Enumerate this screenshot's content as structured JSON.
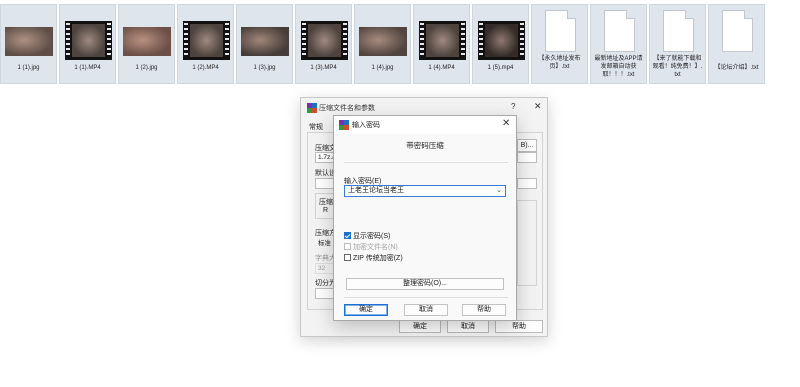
{
  "files": [
    {
      "name": "1 (1).jpg",
      "kind": "image"
    },
    {
      "name": "1 (1).MP4",
      "kind": "video"
    },
    {
      "name": "1 (2).jpg",
      "kind": "image"
    },
    {
      "name": "1 (2).MP4",
      "kind": "video"
    },
    {
      "name": "1 (3).jpg",
      "kind": "image"
    },
    {
      "name": "1 (3).MP4",
      "kind": "video"
    },
    {
      "name": "1 (4).jpg",
      "kind": "image"
    },
    {
      "name": "1 (4).MP4",
      "kind": "video"
    },
    {
      "name": "1 (5).mp4",
      "kind": "video"
    },
    {
      "name": "【永久地址发布页】.txt",
      "kind": "text"
    },
    {
      "name": "最新地址及APP请发邮箱自动获取！！！.txt",
      "kind": "text"
    },
    {
      "name": "【来了就能下载和观看！纯免费！】.txt",
      "kind": "text"
    },
    {
      "name": "【论坛介绍】.txt",
      "kind": "text"
    }
  ],
  "archive_window": {
    "title": "压缩文件名和参数",
    "help_glyph": "?",
    "close_glyph": "✕",
    "tab_general": "常规",
    "label_archive": "压缩文",
    "archive_value": "1.7z.a",
    "browse_partial": "B)...",
    "label_default": "默认设",
    "label_format": "压缩文",
    "radio_partial": "R",
    "label_method": "压缩方",
    "method_value": "标准",
    "label_dict": "字典大",
    "dict_value": "32",
    "label_split": "切分为",
    "ok": "确定",
    "cancel": "取消",
    "help": "帮助"
  },
  "password_dialog": {
    "title": "输入密码",
    "close_glyph": "✕",
    "subtitle": "带密码压缩",
    "password_label": "输入密码(E)",
    "password_value": "上老王论坛当老王",
    "dropdown_glyph": "⌄",
    "show_password": "显示密码(S)",
    "encrypt_names": "加密文件名(N)",
    "zip_legacy": "ZIP 传统加密(Z)",
    "organize_passwords": "整理密码(O)...",
    "ok": "确定",
    "cancel": "取消",
    "help": "帮助"
  }
}
